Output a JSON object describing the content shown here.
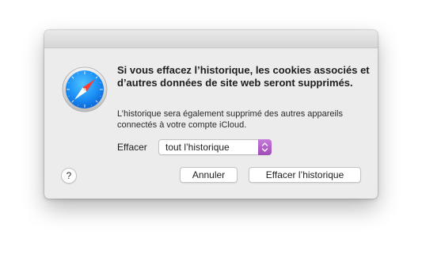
{
  "dialog": {
    "headline": "Si vous effacez l’historique, les cookies associés et d’autres données de site web seront supprimés.",
    "subtext": "L’historique sera également supprimé des autres appareils connectés à votre compte iCloud.",
    "range_label": "Effacer",
    "range_select": {
      "selected": "tout l’historique"
    },
    "help_label": "?",
    "cancel_label": "Annuler",
    "confirm_label": "Effacer l’historique"
  },
  "icons": {
    "app_icon": "safari-compass-icon",
    "stepper_icon": "chevron-up-down-icon"
  },
  "colors": {
    "dialog_background": "#ececec",
    "select_accent": "#b25fc9",
    "compass_blue": "#1a8ef5"
  }
}
